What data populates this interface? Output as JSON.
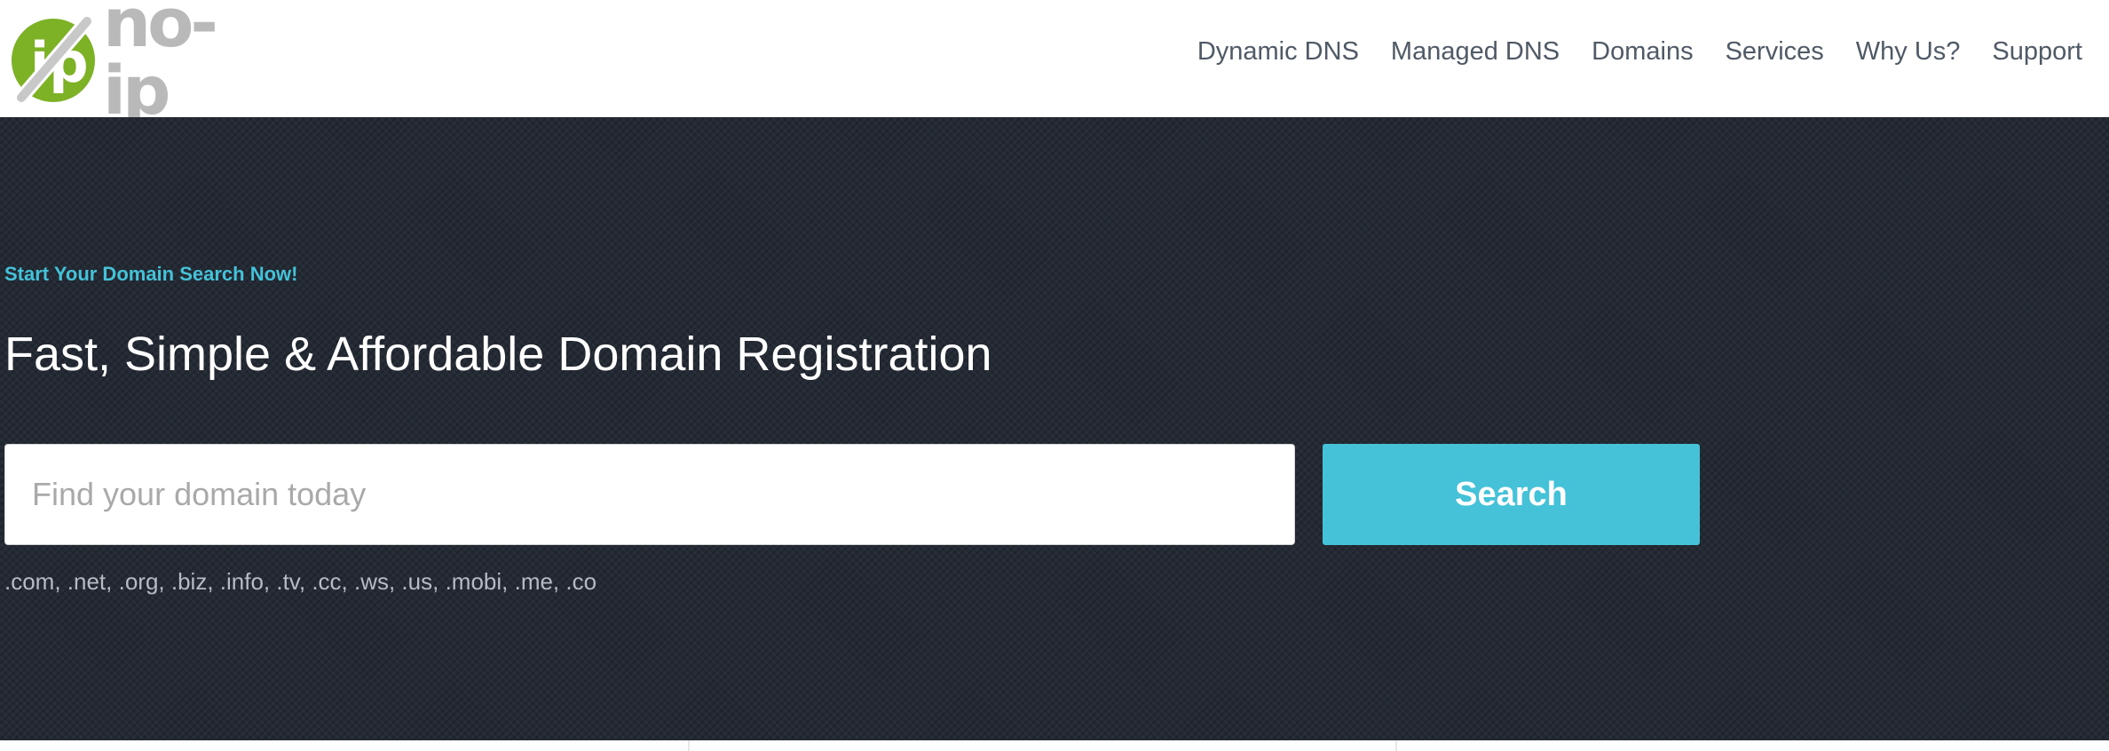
{
  "brand": {
    "wordmark": "no-ip",
    "logo_badge_letters": "ip",
    "badge_color": "#7db227",
    "slash_color": "#c8c8c8",
    "wordmark_color": "#b9b9b9"
  },
  "nav": {
    "items": [
      {
        "label": "Dynamic DNS"
      },
      {
        "label": "Managed DNS"
      },
      {
        "label": "Domains"
      },
      {
        "label": "Services"
      },
      {
        "label": "Why Us?"
      },
      {
        "label": "Support"
      }
    ]
  },
  "hero": {
    "eyebrow": "Start Your Domain Search Now!",
    "headline": "Fast, Simple & Affordable Domain Registration",
    "search": {
      "placeholder": "Find your domain today",
      "value": "",
      "button_label": "Search"
    },
    "tld_list": ".com, .net, .org, .biz, .info, .tv, .cc, .ws, .us, .mobi, .me, .co"
  },
  "colors": {
    "accent": "#45c2d8",
    "hero_background": "#242a34",
    "nav_text": "#4f5a66",
    "tld_text": "#b7bcc2"
  }
}
